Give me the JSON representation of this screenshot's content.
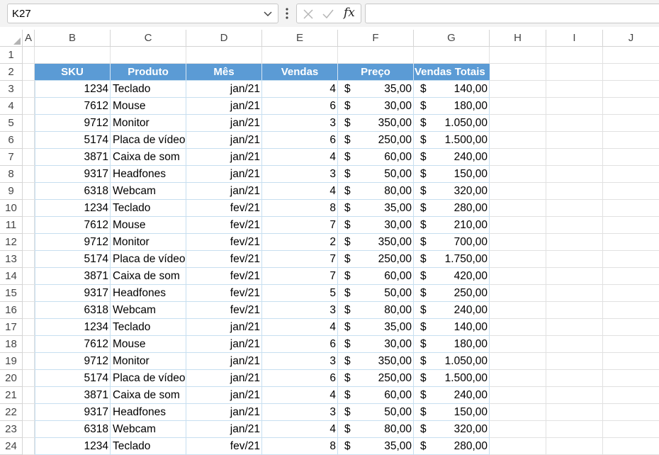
{
  "formula_bar": {
    "name_box": "K27",
    "fx_label": "fx",
    "formula": ""
  },
  "columns": [
    "A",
    "B",
    "C",
    "D",
    "E",
    "F",
    "G",
    "H",
    "I",
    "J"
  ],
  "headers": [
    "SKU",
    "Produto",
    "Mês",
    "Vendas",
    "Preço",
    "Vendas Totais"
  ],
  "currency_symbol": "$",
  "rows": [
    {
      "row": "1"
    },
    {
      "row": "2"
    },
    {
      "row": "3",
      "sku": "1234",
      "produto": "Teclado",
      "mes": "jan/21",
      "vendas": "4",
      "preco": "35,00",
      "total": "140,00"
    },
    {
      "row": "4",
      "sku": "7612",
      "produto": "Mouse",
      "mes": "jan/21",
      "vendas": "6",
      "preco": "30,00",
      "total": "180,00"
    },
    {
      "row": "5",
      "sku": "9712",
      "produto": "Monitor",
      "mes": "jan/21",
      "vendas": "3",
      "preco": "350,00",
      "total": "1.050,00"
    },
    {
      "row": "6",
      "sku": "5174",
      "produto": "Placa de vídeo",
      "mes": "jan/21",
      "vendas": "6",
      "preco": "250,00",
      "total": "1.500,00"
    },
    {
      "row": "7",
      "sku": "3871",
      "produto": "Caixa de som",
      "mes": "jan/21",
      "vendas": "4",
      "preco": "60,00",
      "total": "240,00"
    },
    {
      "row": "8",
      "sku": "9317",
      "produto": "Headfones",
      "mes": "jan/21",
      "vendas": "3",
      "preco": "50,00",
      "total": "150,00"
    },
    {
      "row": "9",
      "sku": "6318",
      "produto": "Webcam",
      "mes": "jan/21",
      "vendas": "4",
      "preco": "80,00",
      "total": "320,00"
    },
    {
      "row": "10",
      "sku": "1234",
      "produto": "Teclado",
      "mes": "fev/21",
      "vendas": "8",
      "preco": "35,00",
      "total": "280,00"
    },
    {
      "row": "11",
      "sku": "7612",
      "produto": "Mouse",
      "mes": "fev/21",
      "vendas": "7",
      "preco": "30,00",
      "total": "210,00"
    },
    {
      "row": "12",
      "sku": "9712",
      "produto": "Monitor",
      "mes": "fev/21",
      "vendas": "2",
      "preco": "350,00",
      "total": "700,00"
    },
    {
      "row": "13",
      "sku": "5174",
      "produto": "Placa de vídeo",
      "mes": "fev/21",
      "vendas": "7",
      "preco": "250,00",
      "total": "1.750,00"
    },
    {
      "row": "14",
      "sku": "3871",
      "produto": "Caixa de som",
      "mes": "fev/21",
      "vendas": "7",
      "preco": "60,00",
      "total": "420,00"
    },
    {
      "row": "15",
      "sku": "9317",
      "produto": "Headfones",
      "mes": "fev/21",
      "vendas": "5",
      "preco": "50,00",
      "total": "250,00"
    },
    {
      "row": "16",
      "sku": "6318",
      "produto": "Webcam",
      "mes": "fev/21",
      "vendas": "3",
      "preco": "80,00",
      "total": "240,00"
    },
    {
      "row": "17",
      "sku": "1234",
      "produto": "Teclado",
      "mes": "jan/21",
      "vendas": "4",
      "preco": "35,00",
      "total": "140,00"
    },
    {
      "row": "18",
      "sku": "7612",
      "produto": "Mouse",
      "mes": "jan/21",
      "vendas": "6",
      "preco": "30,00",
      "total": "180,00"
    },
    {
      "row": "19",
      "sku": "9712",
      "produto": "Monitor",
      "mes": "jan/21",
      "vendas": "3",
      "preco": "350,00",
      "total": "1.050,00"
    },
    {
      "row": "20",
      "sku": "5174",
      "produto": "Placa de vídeo",
      "mes": "jan/21",
      "vendas": "6",
      "preco": "250,00",
      "total": "1.500,00"
    },
    {
      "row": "21",
      "sku": "3871",
      "produto": "Caixa de som",
      "mes": "jan/21",
      "vendas": "4",
      "preco": "60,00",
      "total": "240,00"
    },
    {
      "row": "22",
      "sku": "9317",
      "produto": "Headfones",
      "mes": "jan/21",
      "vendas": "3",
      "preco": "50,00",
      "total": "150,00"
    },
    {
      "row": "23",
      "sku": "6318",
      "produto": "Webcam",
      "mes": "jan/21",
      "vendas": "4",
      "preco": "80,00",
      "total": "320,00"
    },
    {
      "row": "24",
      "sku": "1234",
      "produto": "Teclado",
      "mes": "fev/21",
      "vendas": "8",
      "preco": "35,00",
      "total": "280,00"
    }
  ],
  "colors": {
    "header_fill": "#5b9bd5",
    "header_text": "#ffffff",
    "gridline": "#e1e1e1",
    "table_border": "#c7dff0"
  }
}
